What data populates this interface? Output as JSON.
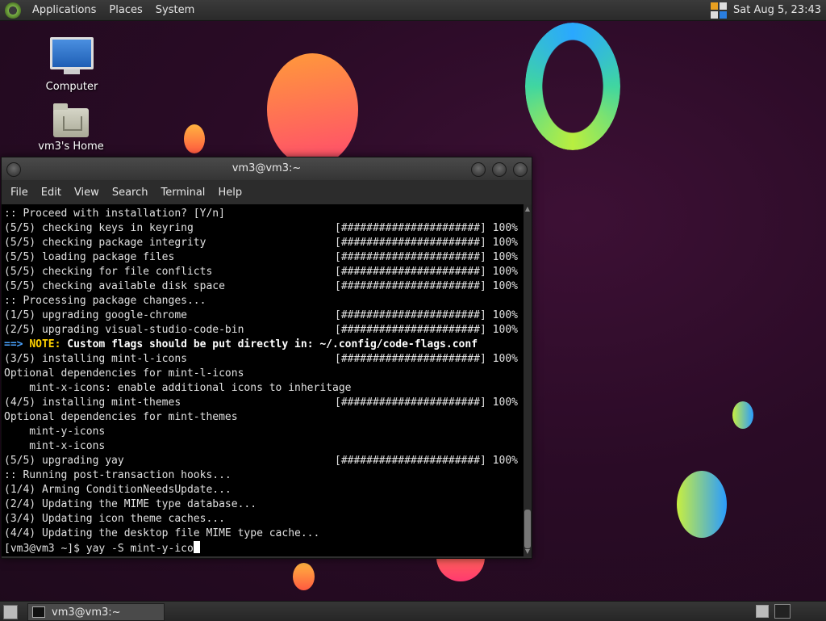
{
  "top_panel": {
    "menus": [
      "Applications",
      "Places",
      "System"
    ],
    "clock": "Sat Aug  5, 23:43"
  },
  "desktop": {
    "icons": [
      {
        "label": "Computer",
        "icon": "computer-icon"
      },
      {
        "label": "vm3's Home",
        "icon": "home-folder-icon"
      }
    ]
  },
  "terminal": {
    "title": "vm3@vm3:~",
    "menu": [
      "File",
      "Edit",
      "View",
      "Search",
      "Terminal",
      "Help"
    ],
    "lines": [
      {
        "text": ":: Proceed with installation? [Y/n]",
        "progress": ""
      },
      {
        "text": "(5/5) checking keys in keyring",
        "progress": "[######################] 100%"
      },
      {
        "text": "(5/5) checking package integrity",
        "progress": "[######################] 100%"
      },
      {
        "text": "(5/5) loading package files",
        "progress": "[######################] 100%"
      },
      {
        "text": "(5/5) checking for file conflicts",
        "progress": "[######################] 100%"
      },
      {
        "text": "(5/5) checking available disk space",
        "progress": "[######################] 100%"
      },
      {
        "text": ":: Processing package changes...",
        "progress": ""
      },
      {
        "text": "(1/5) upgrading google-chrome",
        "progress": "[######################] 100%"
      },
      {
        "text": "(2/5) upgrading visual-studio-code-bin",
        "progress": "[######################] 100%"
      },
      {
        "type": "note",
        "arrow": "==>",
        "label": "NOTE:",
        "text": "Custom flags should be put directly in: ~/.config/code-flags.conf"
      },
      {
        "text": "(3/5) installing mint-l-icons",
        "progress": "[######################] 100%"
      },
      {
        "text": "Optional dependencies for mint-l-icons",
        "progress": ""
      },
      {
        "text": "    mint-x-icons: enable additional icons to inheritage",
        "progress": ""
      },
      {
        "text": "(4/5) installing mint-themes",
        "progress": "[######################] 100%"
      },
      {
        "text": "Optional dependencies for mint-themes",
        "progress": ""
      },
      {
        "text": "    mint-y-icons",
        "progress": ""
      },
      {
        "text": "    mint-x-icons",
        "progress": ""
      },
      {
        "text": "(5/5) upgrading yay",
        "progress": "[######################] 100%"
      },
      {
        "text": ":: Running post-transaction hooks...",
        "progress": ""
      },
      {
        "text": "(1/4) Arming ConditionNeedsUpdate...",
        "progress": ""
      },
      {
        "text": "(2/4) Updating the MIME type database...",
        "progress": ""
      },
      {
        "text": "(3/4) Updating icon theme caches...",
        "progress": ""
      },
      {
        "text": "(4/4) Updating the desktop file MIME type cache...",
        "progress": ""
      }
    ],
    "prompt": "[vm3@vm3 ~]$ ",
    "command": "yay -S mint-y-ico"
  },
  "bottom_panel": {
    "task_label": "vm3@vm3:~"
  }
}
